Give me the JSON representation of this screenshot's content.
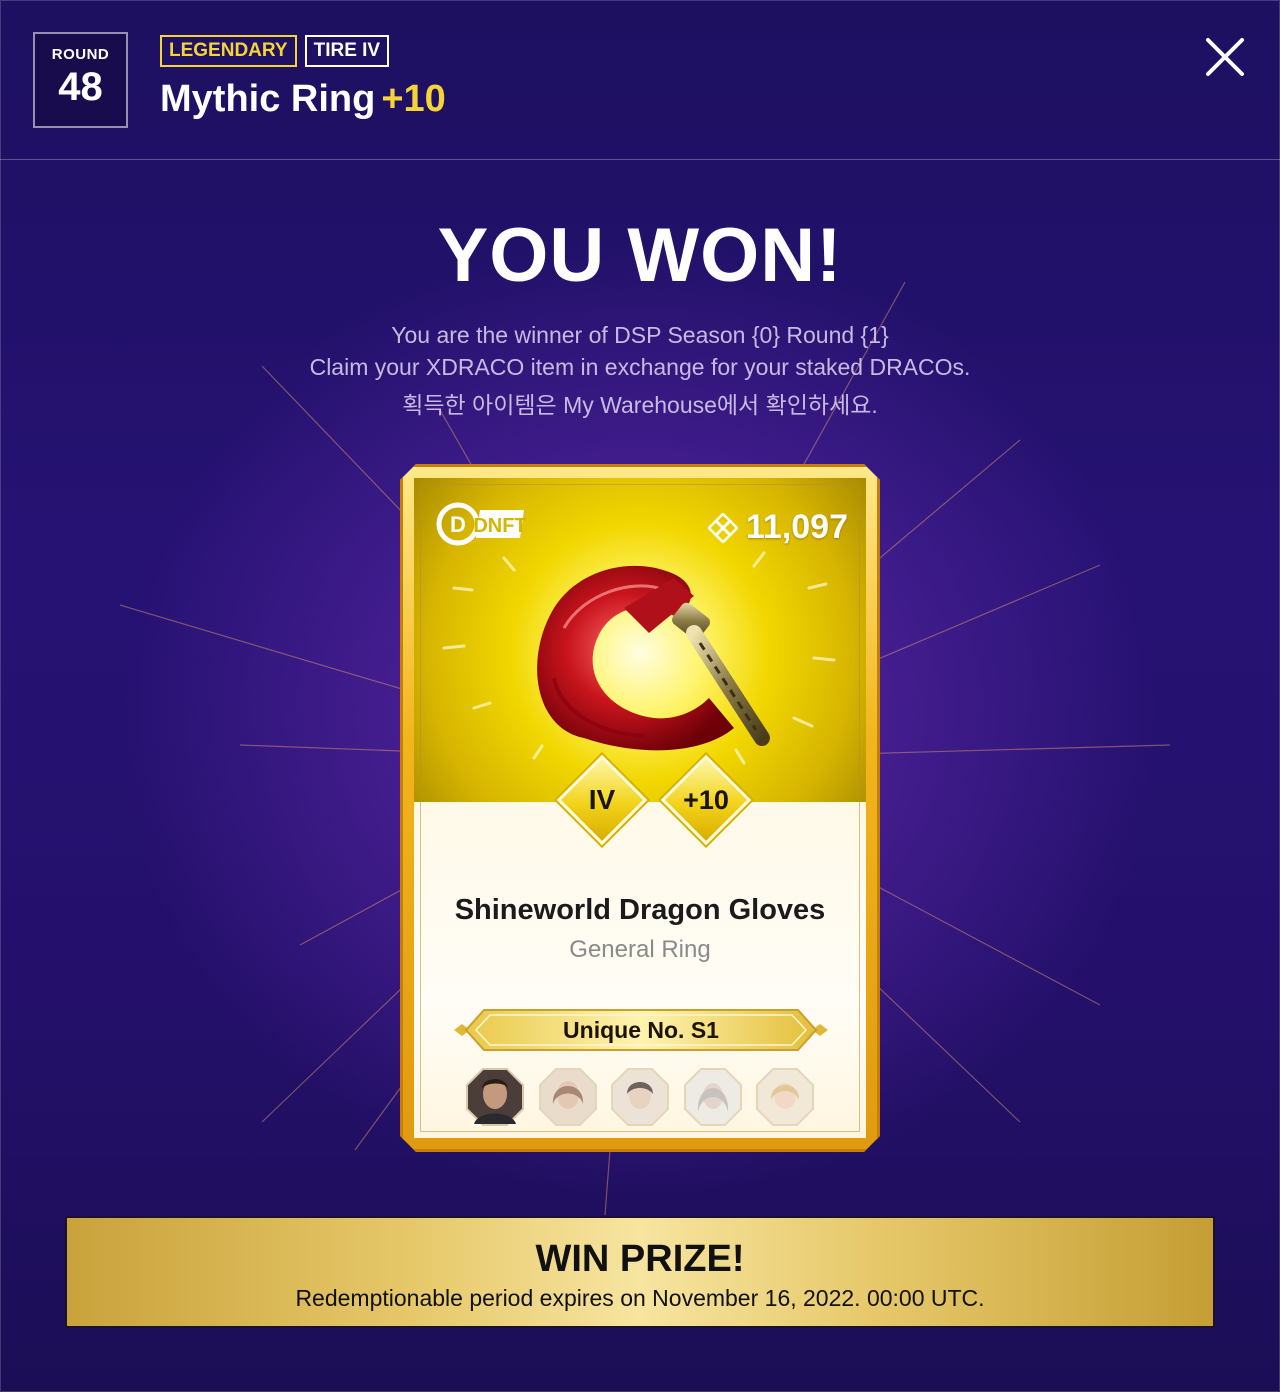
{
  "header": {
    "round_label": "ROUND",
    "round_number": "48",
    "rarity_tag": "LEGENDARY",
    "tier_tag": "TIRE IV",
    "item_name": "Mythic Ring",
    "item_enhance": "+10"
  },
  "result": {
    "title": "YOU WON!",
    "line1": "You are the winner of DSP Season {0} Round {1}",
    "line2": "Claim your XDRACO item in exchange for your staked DRACOs.",
    "line3": "획득한 아이템은 My Warehouse에서 확인하세요."
  },
  "card": {
    "logo": "DNFT",
    "price_icon": "xdraco-icon",
    "price": "11,097",
    "tier": "IV",
    "enhance": "+10",
    "name": "Shineworld Dragon Gloves",
    "category": "General Ring",
    "unique_label": "Unique No. S1",
    "characters": [
      {
        "name": "warrior",
        "active": true
      },
      {
        "name": "sorceress",
        "active": false
      },
      {
        "name": "taoist",
        "active": false
      },
      {
        "name": "berserker",
        "active": false
      },
      {
        "name": "lancer",
        "active": false
      }
    ]
  },
  "prize": {
    "title": "WIN PRIZE!",
    "subtitle": "Redemptionable period expires on November 16, 2022. 00:00 UTC."
  },
  "colors": {
    "accent_yellow": "#f5d438",
    "background": "#24106b",
    "card_gold": "#f2b51c"
  }
}
